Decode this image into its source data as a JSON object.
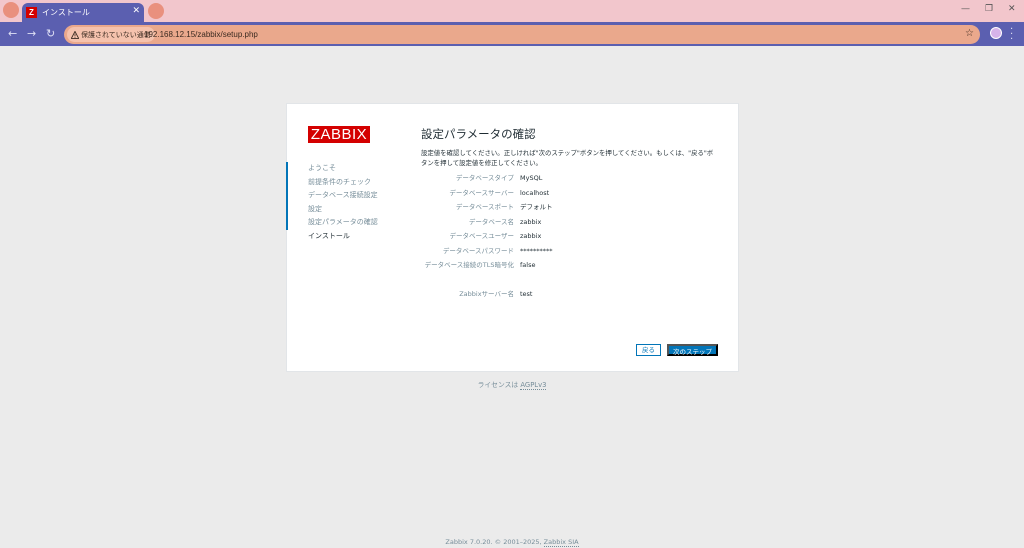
{
  "browser": {
    "tab_title": "インストール",
    "tab_favicon_letter": "Z",
    "security_label": "保護されていない通信",
    "url": "192.168.12.15/zabbix/setup.php"
  },
  "logo": "ZABBIX",
  "steps": [
    {
      "label": "ようこそ",
      "state": "done"
    },
    {
      "label": "前提条件のチェック",
      "state": "done"
    },
    {
      "label": "データベース接続設定",
      "state": "done"
    },
    {
      "label": "設定",
      "state": "done"
    },
    {
      "label": "設定パラメータの確認",
      "state": "done"
    },
    {
      "label": "インストール",
      "state": "current"
    }
  ],
  "main": {
    "heading": "設定パラメータの確認",
    "description": "設定値を確認してください。正しければ\"次のステップ\"ボタンを押してください。もしくは、\"戻る\"ボタンを押して設定値を修正してください。"
  },
  "params": {
    "db_type": {
      "label": "データベースタイプ",
      "value": "MySQL"
    },
    "db_server": {
      "label": "データベースサーバー",
      "value": "localhost"
    },
    "db_port": {
      "label": "データベースポート",
      "value": "デフォルト"
    },
    "db_name": {
      "label": "データベース名",
      "value": "zabbix"
    },
    "db_user": {
      "label": "データベースユーザー",
      "value": "zabbix"
    },
    "db_password": {
      "label": "データベースパスワード",
      "value": "**********"
    },
    "db_tls": {
      "label": "データベース接続のTLS暗号化",
      "value": "false"
    },
    "server_name": {
      "label": "Zabbixサーバー名",
      "value": "test"
    }
  },
  "buttons": {
    "back": "戻る",
    "next": "次のステップ"
  },
  "license": {
    "prefix": "ライセンスは",
    "link": "AGPLv3"
  },
  "footer": {
    "prefix": "Zabbix 7.0.20. © 2001–2025, ",
    "link": "Zabbix SIA"
  },
  "colors": {
    "brand": "#d40000",
    "accent": "#0275b8"
  }
}
